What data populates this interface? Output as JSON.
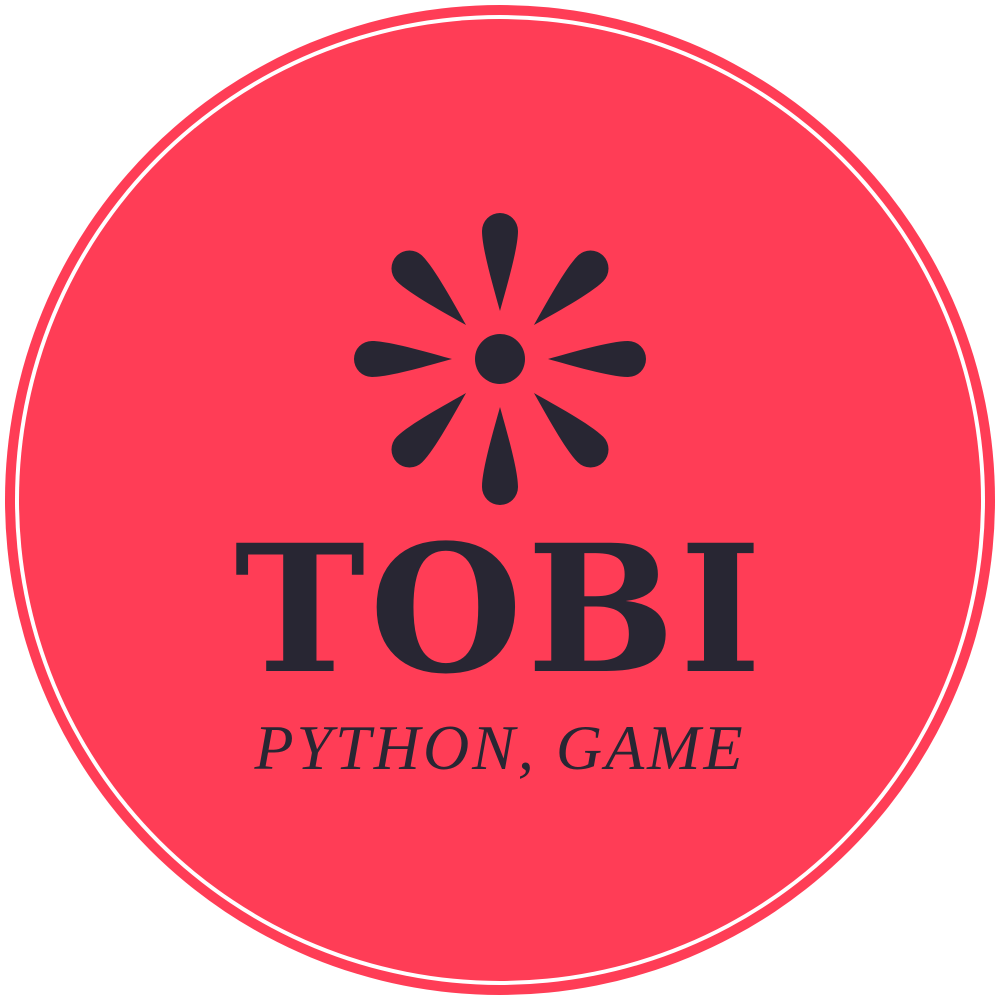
{
  "logo": {
    "title": "TOBI",
    "subtitle": "PYTHON, GAME",
    "icon": "flower-icon",
    "colors": {
      "background": "#ffffff",
      "badge_fill": "#ff3d56",
      "ring": "#ff3d56",
      "ink": "#282633"
    }
  }
}
